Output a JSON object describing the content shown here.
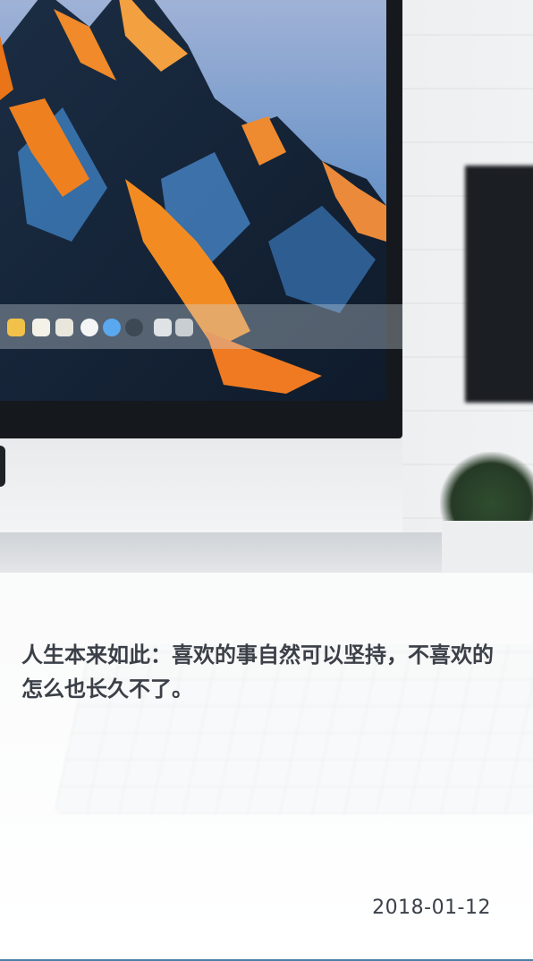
{
  "card": {
    "quote": "人生本来如此：喜欢的事自然可以坚持，不喜欢的怎么也长久不了。",
    "date": "2018-01-12"
  },
  "colors": {
    "text": "#3b4048",
    "accent_line": "#4d7fa6"
  },
  "image": {
    "subject_icon": "desktop-computer-photo"
  }
}
